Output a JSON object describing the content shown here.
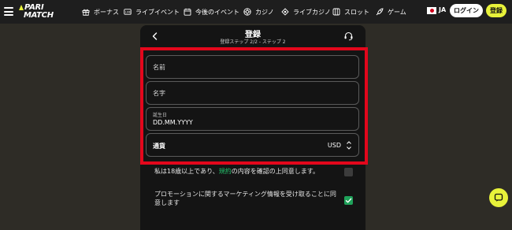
{
  "header": {
    "logo_line1": "PARI",
    "logo_line2": "MATCH",
    "nav": [
      {
        "label": "ボーナス",
        "icon": "gift-icon"
      },
      {
        "label": "ライブイベント",
        "icon": "live-tv-icon"
      },
      {
        "label": "今後のイベント",
        "icon": "calendar-icon"
      },
      {
        "label": "カジノ",
        "icon": "casino-chip-icon"
      },
      {
        "label": "ライブカジノ",
        "icon": "live-casino-icon"
      },
      {
        "label": "スロット",
        "icon": "slot-machine-icon"
      },
      {
        "label": "ゲーム",
        "icon": "rocket-icon"
      }
    ],
    "language": "JA",
    "login_label": "ログイン",
    "register_label": "登録"
  },
  "modal": {
    "title": "登録",
    "subtitle": "登録ステップ 2/2 - ステップ 2",
    "fields": {
      "first_name_placeholder": "名前",
      "last_name_placeholder": "名字",
      "birthdate_label": "誕生日",
      "birthdate_value": "DD.MM.YYYY",
      "currency_label": "通貨",
      "currency_value": "USD"
    },
    "age_consent": {
      "text_before": "私は18歳以上であり、",
      "link": "規約",
      "text_after": "の内容を確認の上同意します。",
      "checked": false
    },
    "marketing_consent": {
      "line1": "プロモーションに関するマーケティング情報を受け取ることに同",
      "line2": "意します",
      "checked": true
    }
  },
  "colors": {
    "accent_yellow": "#e8f23a",
    "highlight_red": "#e3071c",
    "link_green": "#23c16b",
    "checkbox_green": "#1fa25a"
  }
}
